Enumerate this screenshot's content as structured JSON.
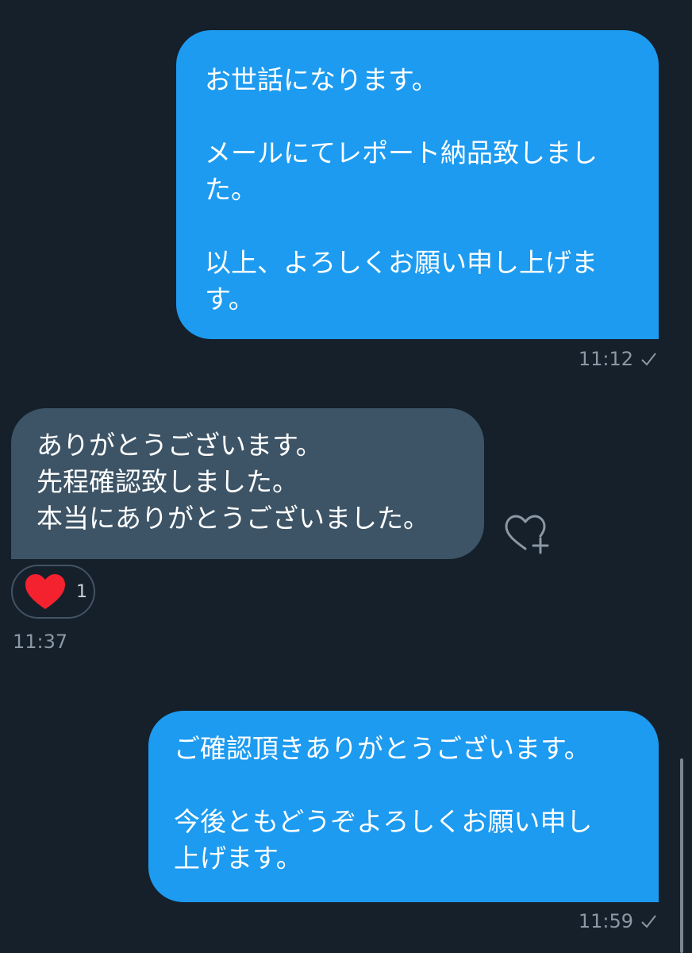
{
  "messages": [
    {
      "direction": "sent",
      "text": "お世話になります。\n\nメールにてレポート納品致しまし\nた。\n\n以上、よろしくお願い申し上げま\nす。",
      "time": "11:12"
    },
    {
      "direction": "received",
      "text": "ありがとうございます。\n先程確認致しました。\n本当にありがとうございました。",
      "time": "11:37",
      "reaction": {
        "emoji": "heart",
        "count": "1"
      }
    },
    {
      "direction": "sent",
      "text": "ご確認頂きありがとうございます。\n\n今後ともどうぞよろしくお願い申し\n上げます。",
      "time": "11:59"
    }
  ],
  "icons": {
    "read_receipt": "check-icon",
    "add_reaction": "heart-plus-icon",
    "reaction": "red-heart-icon",
    "scrollbar": "scrollbar"
  },
  "colors": {
    "background": "#15202b",
    "sent_bubble": "#1d9bf0",
    "received_bubble": "#3d5466",
    "meta_text": "#8b98a5",
    "heart": "#f4212e"
  }
}
